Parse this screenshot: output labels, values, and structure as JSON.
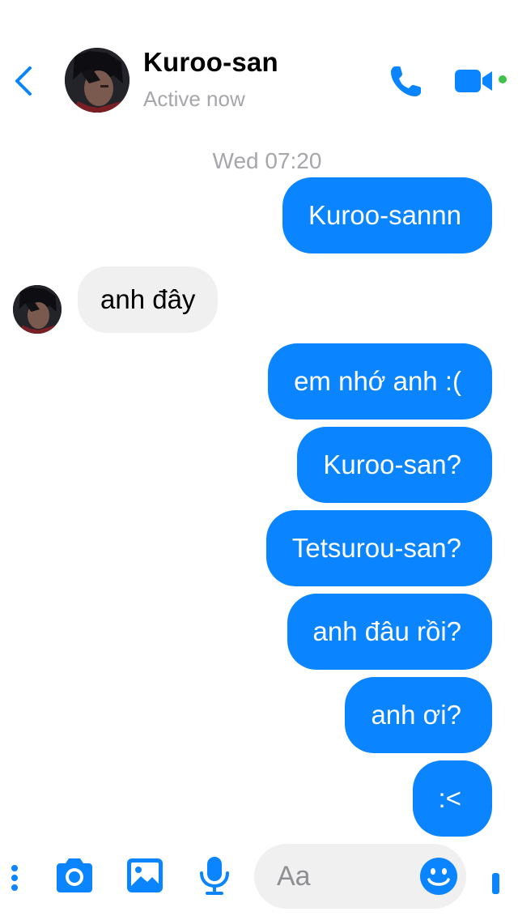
{
  "header": {
    "contact_name": "Kuroo-san",
    "status": "Active now"
  },
  "conversation": {
    "timestamp": "Wed 07:20",
    "messages": [
      {
        "from": "me",
        "text": "Kuroo-sannn"
      },
      {
        "from": "contact",
        "text": "anh đây"
      },
      {
        "from": "me",
        "text": "em nhớ anh :("
      },
      {
        "from": "me",
        "text": "Kuroo-san?"
      },
      {
        "from": "me",
        "text": "Tetsurou-san?"
      },
      {
        "from": "me",
        "text": "anh đâu rồi?"
      },
      {
        "from": "me",
        "text": "anh ơi?"
      },
      {
        "from": "me",
        "text": ":<"
      }
    ]
  },
  "composer": {
    "placeholder": "Aa"
  },
  "icons": {
    "back": "chevron-left-icon",
    "call": "phone-icon",
    "video": "video-camera-icon",
    "more": "more-icon",
    "camera": "camera-icon",
    "gallery": "image-icon",
    "voice": "microphone-icon",
    "emoji": "emoji-icon",
    "like": "thumbs-up-icon"
  },
  "colors": {
    "accent": "#0a84ff",
    "incoming_bubble": "#f0f0f0",
    "muted_text": "#a6a6ab",
    "online": "#3fc349"
  }
}
